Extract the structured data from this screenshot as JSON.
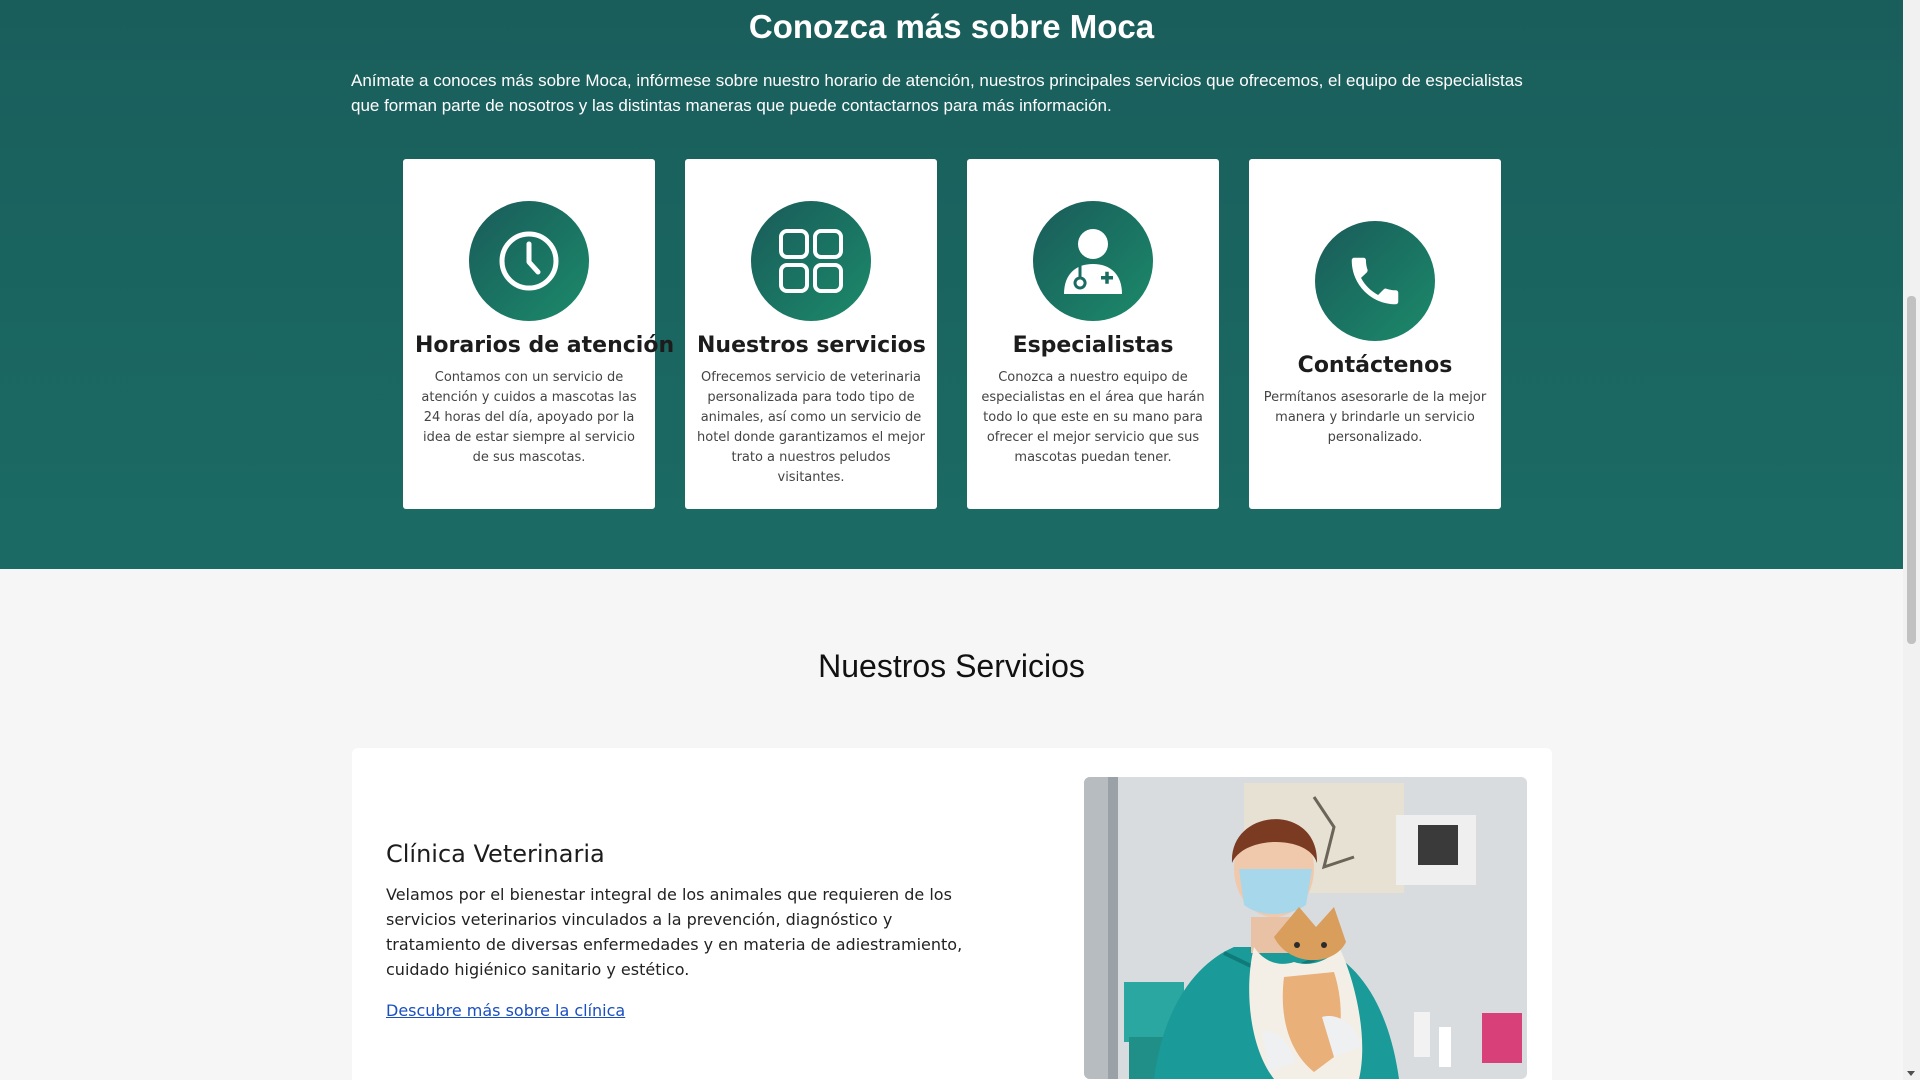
{
  "hero": {
    "title": "Conozca más sobre Moca",
    "description": "Anímate a conoces más sobre Moca, infórmese sobre nuestro horario de atención, nuestros principales servicios que ofrecemos, el equipo de especialistas que forman parte de nosotros y las distintas maneras que puede contactarnos para más información.",
    "cards": [
      {
        "icon": "clock-icon",
        "title": "Horarios de atención",
        "text": "Contamos con un servicio de atención y cuidos a mascotas las 24 horas del día, apoyado por la idea de estar siempre al servicio de sus mascotas."
      },
      {
        "icon": "grid-icon",
        "title": "Nuestros servicios",
        "text": "Ofrecemos servicio de veterinaria personalizada para todo tipo de animales, así como un servicio de hotel donde garantizamos el mejor trato a nuestros peludos visitantes."
      },
      {
        "icon": "doctor-icon",
        "title": "Especialistas",
        "text": "Conozca a nuestro equipo de especialistas en el área que harán todo lo que este en su mano para ofrecer el mejor servicio que sus mascotas puedan tener."
      },
      {
        "icon": "phone-icon",
        "title": "Contáctenos",
        "text": "Permítanos asesorarle de la mejor manera y brindarle un servicio personalizado."
      }
    ]
  },
  "services": {
    "title": "Nuestros Servicios",
    "item": {
      "title": "Clínica Veterinaria",
      "text": "Velamos por el bienestar integral de los animales que requieren de los servicios veterinarios vinculados a la prevención, diagnóstico y tratamiento de diversas enfermedades y en materia de adiestramiento, cuidado higiénico sanitario y estético.",
      "link": "Descubre más sobre la clínica",
      "photo": "vet-with-cat-photo"
    }
  },
  "colors": {
    "hero_bg": "#1a5e5c",
    "icon_gradient_start": "#1a5b5a",
    "icon_gradient_end": "#1b8a6a",
    "link": "#1a4fc0"
  }
}
